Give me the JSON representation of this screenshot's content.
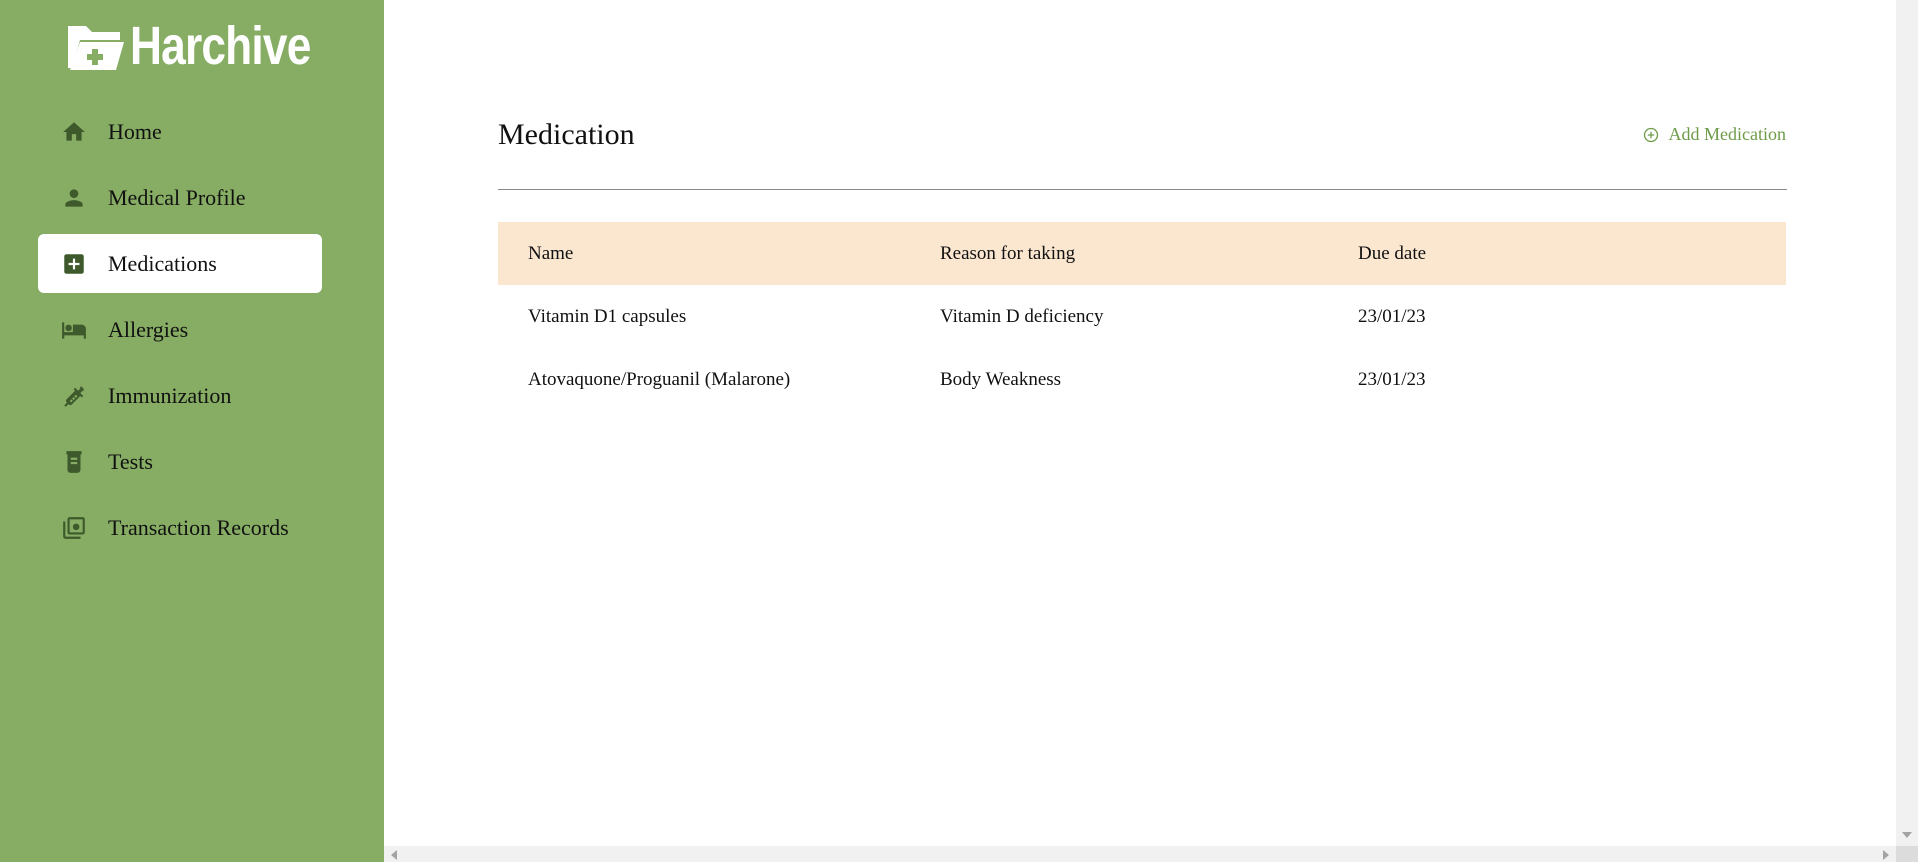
{
  "brand": {
    "name": "Harchive",
    "logo_icon": "folder-medical-icon"
  },
  "sidebar": {
    "items": [
      {
        "label": "Home",
        "icon": "home-icon",
        "active": false
      },
      {
        "label": "Medical Profile",
        "icon": "person-icon",
        "active": false
      },
      {
        "label": "Medications",
        "icon": "medical-plus-icon",
        "active": true
      },
      {
        "label": "Allergies",
        "icon": "bed-icon",
        "active": false
      },
      {
        "label": "Immunization",
        "icon": "syringe-icon",
        "active": false
      },
      {
        "label": "Tests",
        "icon": "test-jar-icon",
        "active": false
      },
      {
        "label": "Transaction Records",
        "icon": "money-records-icon",
        "active": false
      }
    ]
  },
  "main": {
    "title": "Medication",
    "add_button": {
      "label": "Add Medication",
      "icon": "plus-circle-icon"
    },
    "table": {
      "headers": [
        "Name",
        "Reason for taking",
        "Due date"
      ],
      "rows": [
        [
          "Vitamin D1 capsules",
          "Vitamin D deficiency",
          "23/01/23"
        ],
        [
          "Atovaquone/Proguanil (Malarone)",
          "Body Weakness",
          "23/01/23"
        ]
      ]
    }
  },
  "colors": {
    "sidebar_bg": "#86ad63",
    "icon": "#3e5a2c",
    "accent": "#6e9b48",
    "table_header_bg": "#fbe6d0"
  }
}
